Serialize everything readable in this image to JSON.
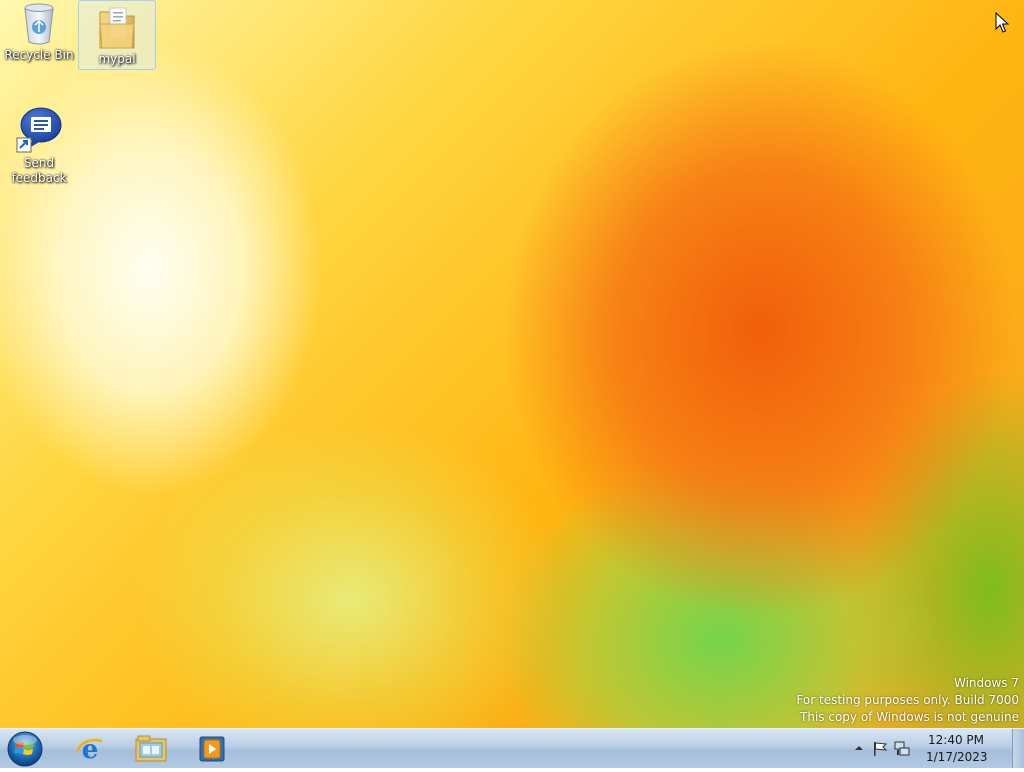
{
  "desktop": {
    "icons": [
      {
        "label": "Recycle Bin",
        "icon": "recycle-bin-icon"
      },
      {
        "label": "mypal",
        "icon": "folder-icon",
        "selected": true
      },
      {
        "label": "Send feedback",
        "icon": "send-feedback-icon"
      }
    ],
    "watermark": {
      "line1": "Windows 7",
      "line2": "For testing purposes only. Build 7000",
      "line3": "This copy of Windows is not genuine"
    }
  },
  "taskbar": {
    "start_icon": "windows-start-icon",
    "pinned": [
      {
        "icon": "internet-explorer-icon"
      },
      {
        "icon": "windows-explorer-icon"
      },
      {
        "icon": "media-player-icon"
      }
    ],
    "tray": {
      "icons": [
        "show-hidden-icons-icon",
        "action-center-flag-icon",
        "network-icon"
      ],
      "time": "12:40 PM",
      "date": "1/17/2023"
    }
  },
  "colors": {
    "taskbar": "#b8cde4",
    "wallpaper_orange": "#f57010",
    "wallpaper_yellow": "#ffd640",
    "wallpaper_green": "#6ed750"
  }
}
